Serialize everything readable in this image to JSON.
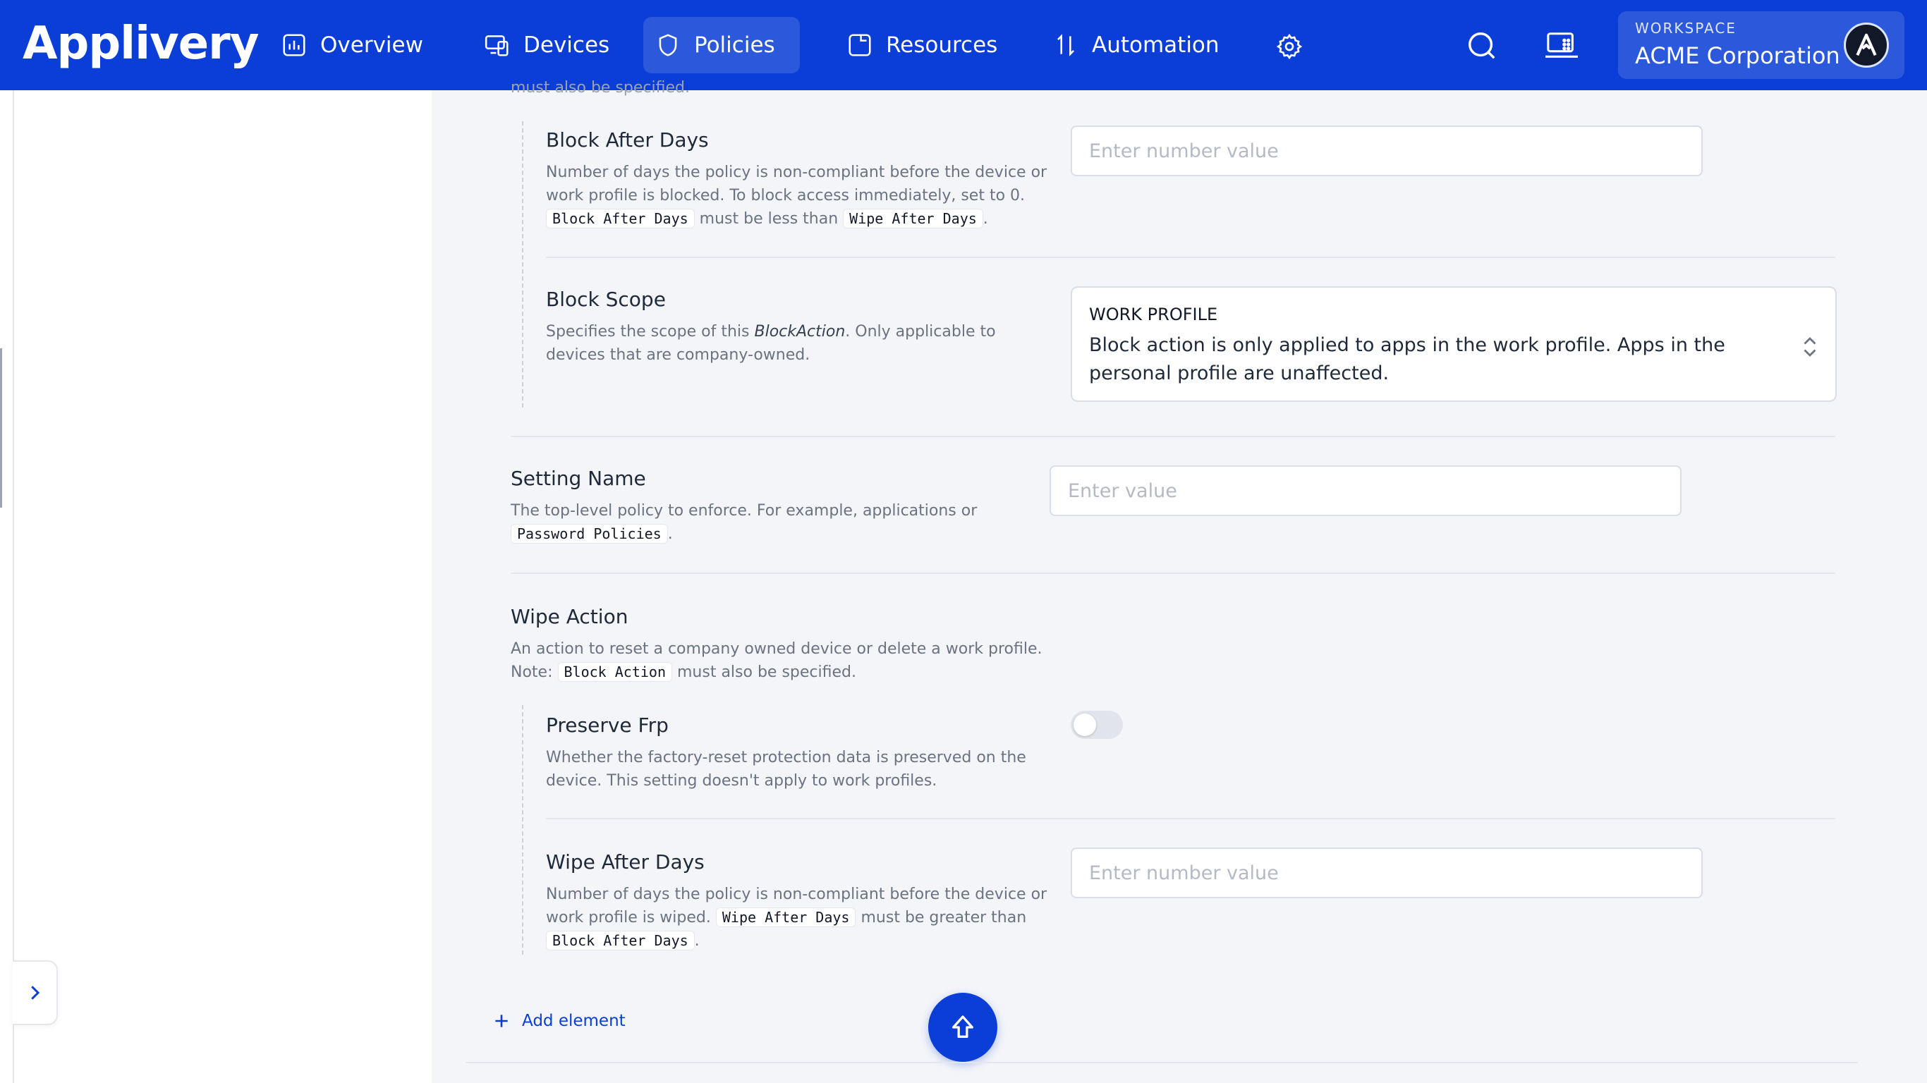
{
  "nav": {
    "logo": "Applivery",
    "items": [
      {
        "label": "Overview"
      },
      {
        "label": "Devices"
      },
      {
        "label": "Policies"
      },
      {
        "label": "Resources"
      },
      {
        "label": "Automation"
      }
    ],
    "active": "Policies",
    "workspace_label": "WORKSPACE",
    "workspace_name": "ACME Corporation"
  },
  "colors": {
    "brand": "#0a3ed6",
    "panel_bg": "#f3f5f9"
  },
  "cut_text": "must also be specified.",
  "fields": {
    "block_after_days": {
      "title": "Block After Days",
      "desc_1": "Number of days the policy is non-compliant before the device or work profile is blocked. To block access immediately, set to 0.",
      "code_1": "Block After Days",
      "mid": "must be less than",
      "code_2": "Wipe After Days",
      "end": ".",
      "placeholder": "Enter number value"
    },
    "block_scope": {
      "title": "Block Scope",
      "desc_1": "Specifies the scope of this",
      "desc_italic": "BlockAction",
      "desc_2": ". Only applicable to devices that are company-owned.",
      "selected_title": "WORK PROFILE",
      "selected_desc": "Block action is only applied to apps in the work profile. Apps in the personal profile are unaffected."
    },
    "setting_name": {
      "title": "Setting Name",
      "desc_1": "The top-level policy to enforce. For example, applications or",
      "code_1": "Password Policies",
      "end": ".",
      "placeholder": "Enter value"
    },
    "wipe_action": {
      "title": "Wipe Action",
      "desc_1": "An action to reset a company owned device or delete a work profile.",
      "note": "Note:",
      "code_1": "Block Action",
      "desc_2": "must also be specified."
    },
    "preserve_frp": {
      "title": "Preserve Frp",
      "desc": "Whether the factory-reset protection data is preserved on the device. This setting doesn't apply to work profiles.",
      "enabled": false
    },
    "wipe_after_days": {
      "title": "Wipe After Days",
      "desc_1": "Number of days the policy is non-compliant before the device or work profile is wiped.",
      "code_1": "Wipe After Days",
      "mid": "must be greater than",
      "code_2": "Block After Days",
      "end": ".",
      "placeholder": "Enter number value"
    }
  },
  "add_element_label": "Add element",
  "icons": {
    "overview": "chart-icon",
    "devices": "devices-icon",
    "policies": "shield-icon",
    "resources": "folder-icon",
    "automation": "automation-icon",
    "settings": "gear-icon",
    "search": "search-icon",
    "device_list": "device-list-icon",
    "avatar": "logo-a-icon",
    "expand": "chevron-right-icon",
    "add": "plus-icon",
    "scroll_top": "arrow-up-icon",
    "select": "chevron-up-down-icon"
  }
}
